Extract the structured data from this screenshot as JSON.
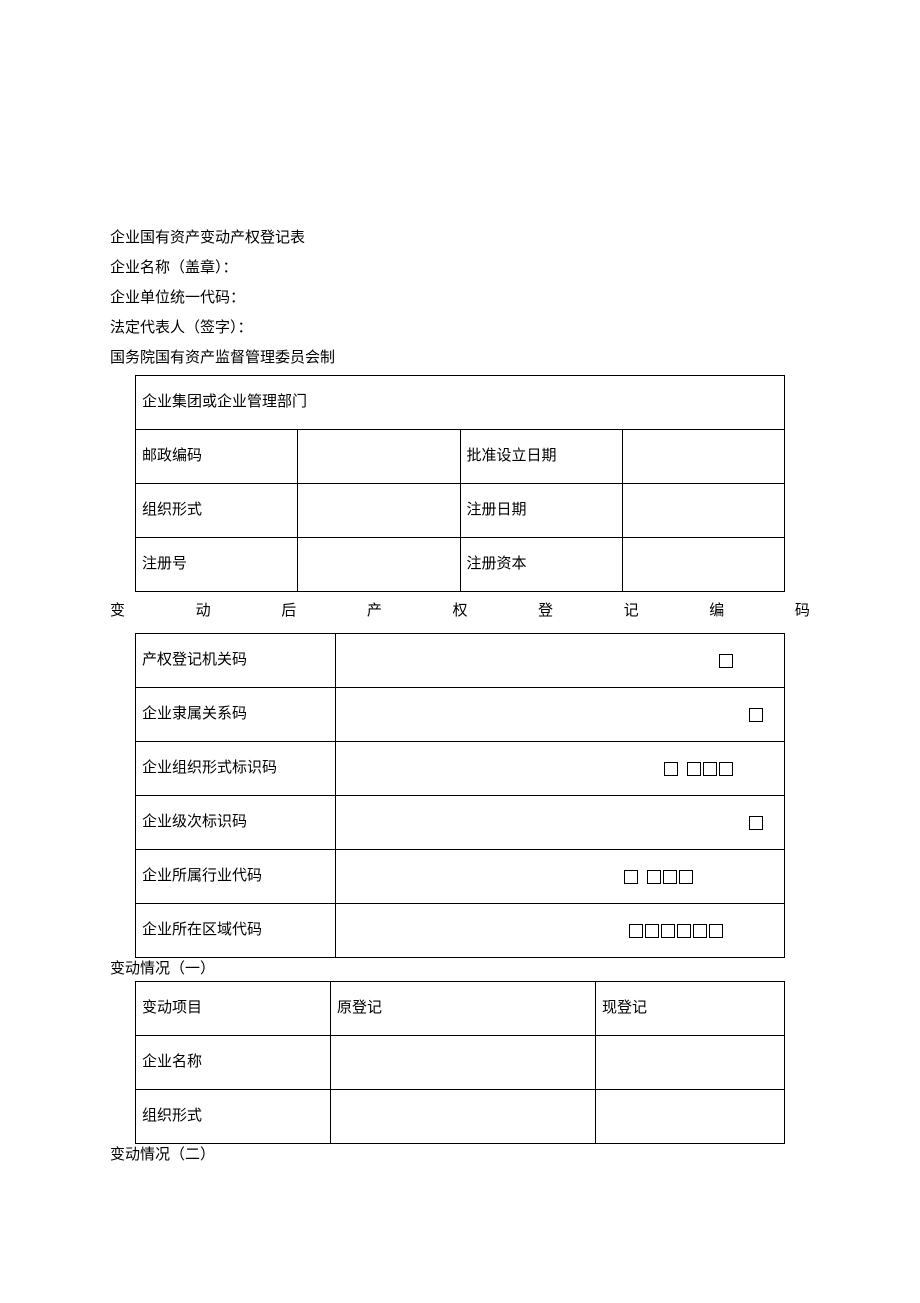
{
  "header": {
    "title": "企业国有资产变动产权登记表",
    "name_label": "企业名称（盖章）：",
    "code_label": "企业单位统一代码：",
    "legal_rep_label": "法定代表人（签字）：",
    "issuer": "国务院国有资产监督管理委员会制"
  },
  "table1": {
    "r1c1": "企业集团或企业管理部门",
    "r2c1": "邮政编码",
    "r2c3": "批准设立日期",
    "r3c1": "组织形式",
    "r3c3": "注册日期",
    "r4c1": "注册号",
    "r4c3": "注册资本"
  },
  "spread_title": {
    "c1": "变",
    "c2": "动",
    "c3": "后",
    "c4": "产",
    "c5": "权",
    "c6": "登",
    "c7": "记",
    "c8": "编",
    "c9": "码"
  },
  "table2": {
    "r1": "产权登记机关码",
    "r2": "企业隶属关系码",
    "r3": "企业组织形式标识码",
    "r4": "企业级次标识码",
    "r5": "企业所属行业代码",
    "r6": "企业所在区域代码"
  },
  "section1_label": "变动情况（一）",
  "table3": {
    "h1": "变动项目",
    "h2": "原登记",
    "h3": "现登记",
    "r1": "企业名称",
    "r2": "组织形式"
  },
  "section2_label": "变动情况（二）"
}
